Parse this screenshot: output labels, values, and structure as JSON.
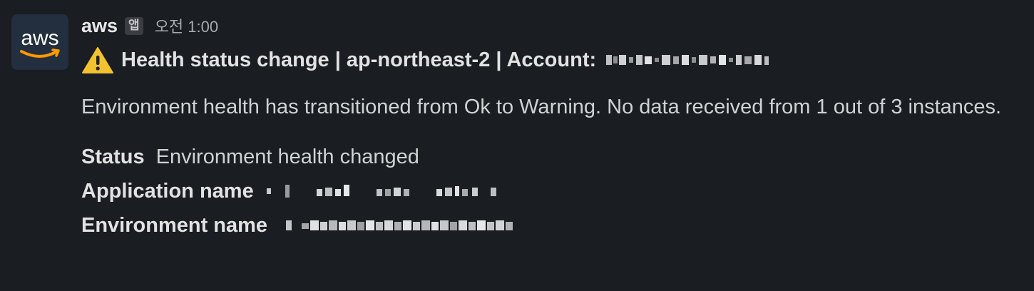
{
  "message": {
    "sender": "aws",
    "app_badge": "앱",
    "timestamp": "오전 1:00",
    "avatar_text": "aws",
    "title": "Health status change | ap-northeast-2 | Account:",
    "body": "Environment health has transitioned from Ok to Warning. No data received from 1 out of 3 instances.",
    "fields": [
      {
        "label": "Status",
        "value": "Environment health changed"
      },
      {
        "label": "Application name",
        "value": ""
      },
      {
        "label": "Environment name",
        "value": ""
      }
    ]
  },
  "colors": {
    "background": "#1a1d21",
    "text": "#d1d2d3",
    "avatar_bg": "#232f3e",
    "aws_orange": "#ff9900",
    "warning": "#f2c230"
  },
  "icons": {
    "avatar": "aws-logo-icon",
    "title": "warning-icon"
  }
}
